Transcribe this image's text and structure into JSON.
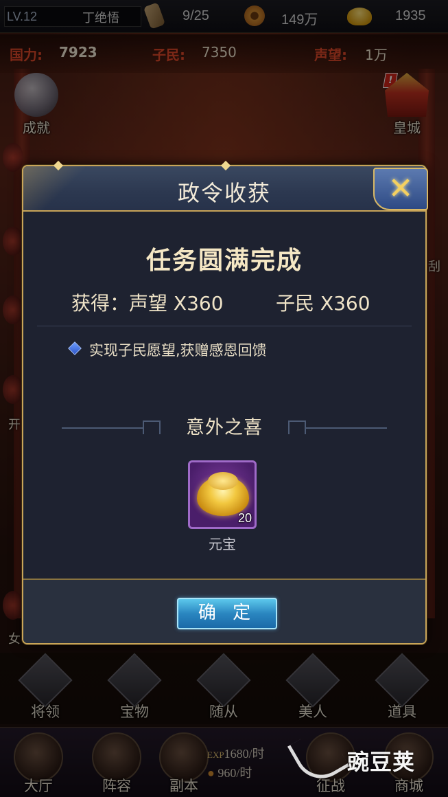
{
  "topbar": {
    "level": "LV.12",
    "player_name": "丁绝悟",
    "orders": "9/25",
    "copper": "149万",
    "gold": "1935"
  },
  "stats": {
    "power_label": "国力:",
    "power_value": "7923",
    "citizens_label": "子民:",
    "citizens_value": "7350",
    "prestige_label": "声望:",
    "prestige_value": "1万"
  },
  "side": {
    "achievement": "成就",
    "imperial_city": "皇城",
    "left_partial_1": "开",
    "left_partial_2": "女",
    "right_partial": "刮"
  },
  "modal": {
    "title": "政令收获",
    "headline": "任务圆满完成",
    "reward_prestige": "获得：声望 X360",
    "reward_citizens": "子民 X360",
    "note": "实现子民愿望,获赠感恩回馈",
    "surprise_title": "意外之喜",
    "item": {
      "name": "元宝",
      "count": "20",
      "icon": "gold-ingot-icon"
    },
    "confirm_label": "确 定",
    "close_icon": "close-x-icon"
  },
  "nav": [
    "将领",
    "宝物",
    "随从",
    "美人",
    "道具"
  ],
  "dock": {
    "items": [
      "大厅",
      "阵容",
      "副本",
      "征战",
      "商城"
    ],
    "exp_tag": "EXP",
    "exp_rate": "1680/时",
    "coin_rate": "960/时"
  },
  "watermark": "豌豆荚",
  "colors": {
    "accent_gold": "#c9a558",
    "power_red": "#e24a2a",
    "confirm_blue": "#2a86c0",
    "modal_bg": "#1e2230"
  }
}
